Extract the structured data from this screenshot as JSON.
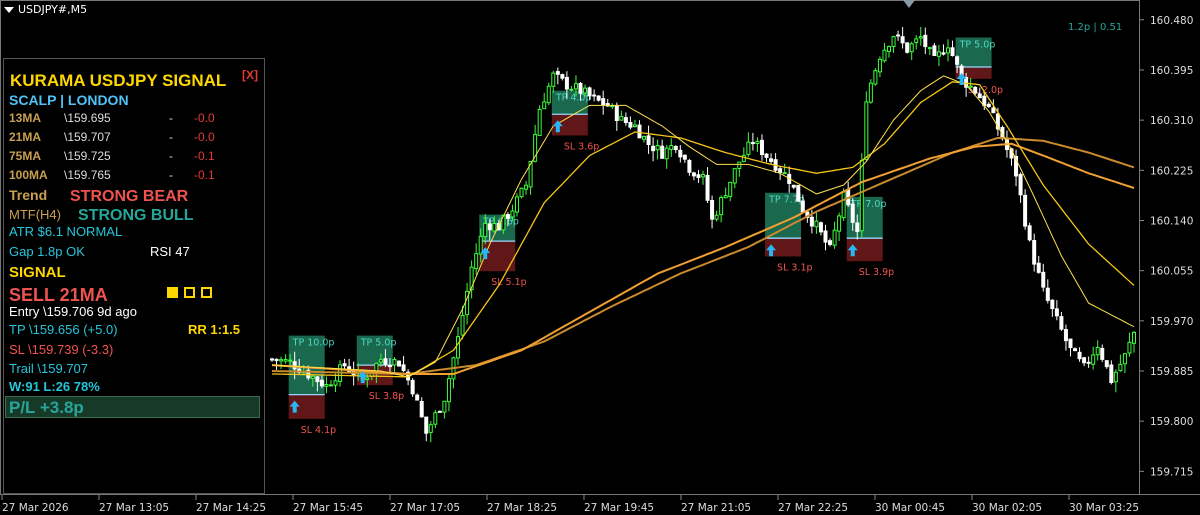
{
  "window": {
    "symbol": "USDJPY#,M5",
    "top_right_label": "1.2p | 0.51"
  },
  "panel": {
    "title": "KURAMA USDJPY SIGNAL",
    "close_label": "[X]",
    "subtitle": "SCALP | LONDON",
    "ma_rows": [
      {
        "label": "13MA",
        "value": "\\159.695",
        "dash": "-",
        "diff": "-0.0"
      },
      {
        "label": "21MA",
        "value": "\\159.707",
        "dash": "-",
        "diff": "-0.0"
      },
      {
        "label": "75MA",
        "value": "\\159.725",
        "dash": "-",
        "diff": "-0.1"
      },
      {
        "label": "100MA",
        "value": "\\159.765",
        "dash": "-",
        "diff": "-0.1"
      }
    ],
    "trend_label": "Trend",
    "trend_value": "STRONG BEAR",
    "mtf_label": "MTF(H4)",
    "mtf_value": "STRONG BULL",
    "atr": "ATR $6.1 NORMAL",
    "gap": "Gap 1.8p OK",
    "rsi": "RSI 47",
    "signal_heading": "SIGNAL",
    "signal_value": "SELL  21MA",
    "signal_strength": [
      true,
      false,
      false
    ],
    "entry": "Entry  \\159.706   9d ago",
    "tp": "TP  \\159.656  (+5.0)",
    "rr": "RR 1:1.5",
    "sl": "SL  \\159.739  (-3.3)",
    "trail": "Trail  \\159.707",
    "winloss": "W:91 L:26  78%",
    "pl": "P/L  +3.8p"
  },
  "colors": {
    "background": "#000000",
    "bull_candle": "#3bff3b",
    "bear_candle": "#ffffff",
    "ma_fast": "#ffe14d",
    "ma_slow": "#f0a030",
    "tp_zone": "#1f7a5c",
    "sl_zone": "#6b1a1a",
    "arrow": "#29b6f6"
  },
  "chart_data": {
    "type": "candlestick",
    "y_ticks": [
      "160.480",
      "160.395",
      "160.310",
      "160.225",
      "160.140",
      "160.055",
      "159.970",
      "159.885",
      "159.800",
      "159.715"
    ],
    "ylim": [
      159.68,
      160.5
    ],
    "x_ticks": [
      "27 Mar 2026",
      "27 Mar 13:05",
      "27 Mar 14:25",
      "27 Mar 15:45",
      "27 Mar 17:05",
      "27 Mar 18:25",
      "27 Mar 19:45",
      "27 Mar 21:05",
      "27 Mar 22:25",
      "30 Mar 00:45",
      "30 Mar 02:05",
      "30 Mar 03:25"
    ],
    "close_path": [
      [
        0,
        159.905
      ],
      [
        4,
        159.9
      ],
      [
        8,
        159.88
      ],
      [
        12,
        159.86
      ],
      [
        16,
        159.895
      ],
      [
        20,
        159.87
      ],
      [
        24,
        159.905
      ],
      [
        28,
        159.9
      ],
      [
        31,
        159.855
      ],
      [
        34,
        159.78
      ],
      [
        38,
        159.84
      ],
      [
        41,
        159.94
      ],
      [
        44,
        160.06
      ],
      [
        47,
        160.135
      ],
      [
        50,
        160.13
      ],
      [
        53,
        160.16
      ],
      [
        56,
        160.2
      ],
      [
        59,
        160.33
      ],
      [
        62,
        160.385
      ],
      [
        65,
        160.37
      ],
      [
        68,
        160.36
      ],
      [
        71,
        160.345
      ],
      [
        74,
        160.335
      ],
      [
        77,
        160.31
      ],
      [
        80,
        160.3
      ],
      [
        83,
        160.27
      ],
      [
        86,
        160.255
      ],
      [
        89,
        160.27
      ],
      [
        92,
        160.23
      ],
      [
        95,
        160.21
      ],
      [
        97,
        160.14
      ],
      [
        100,
        160.19
      ],
      [
        103,
        160.24
      ],
      [
        106,
        160.275
      ],
      [
        109,
        160.25
      ],
      [
        111,
        160.235
      ],
      [
        114,
        160.21
      ],
      [
        117,
        160.16
      ],
      [
        120,
        160.13
      ],
      [
        123,
        160.09
      ],
      [
        126,
        160.18
      ],
      [
        129,
        160.12
      ],
      [
        131,
        160.35
      ],
      [
        134,
        160.42
      ],
      [
        137,
        160.455
      ],
      [
        140,
        160.43
      ],
      [
        143,
        160.45
      ],
      [
        146,
        160.41
      ],
      [
        149,
        160.44
      ],
      [
        152,
        160.38
      ],
      [
        155,
        160.36
      ],
      [
        158,
        160.33
      ],
      [
        161,
        160.28
      ],
      [
        164,
        160.22
      ],
      [
        167,
        160.1
      ],
      [
        170,
        160.02
      ],
      [
        173,
        159.97
      ],
      [
        176,
        159.92
      ],
      [
        179,
        159.89
      ],
      [
        182,
        159.93
      ],
      [
        185,
        159.87
      ],
      [
        188,
        159.91
      ],
      [
        190,
        159.95
      ]
    ],
    "ma_fast": [
      [
        0,
        159.895
      ],
      [
        24,
        159.885
      ],
      [
        30,
        159.875
      ],
      [
        36,
        159.9
      ],
      [
        42,
        159.99
      ],
      [
        48,
        160.1
      ],
      [
        55,
        160.21
      ],
      [
        62,
        160.3
      ],
      [
        70,
        160.335
      ],
      [
        78,
        160.335
      ],
      [
        86,
        160.3
      ],
      [
        92,
        160.265
      ],
      [
        98,
        160.235
      ],
      [
        105,
        160.235
      ],
      [
        112,
        160.22
      ],
      [
        120,
        160.185
      ],
      [
        126,
        160.2
      ],
      [
        131,
        160.24
      ],
      [
        137,
        160.31
      ],
      [
        143,
        160.36
      ],
      [
        148,
        160.385
      ],
      [
        153,
        160.37
      ],
      [
        158,
        160.325
      ],
      [
        163,
        160.26
      ],
      [
        168,
        160.18
      ],
      [
        174,
        160.08
      ],
      [
        180,
        160.0
      ],
      [
        190,
        159.96
      ]
    ],
    "ma_mid": [
      [
        0,
        159.88
      ],
      [
        30,
        159.875
      ],
      [
        40,
        159.92
      ],
      [
        50,
        160.03
      ],
      [
        60,
        160.17
      ],
      [
        70,
        160.25
      ],
      [
        80,
        160.29
      ],
      [
        90,
        160.28
      ],
      [
        100,
        160.255
      ],
      [
        110,
        160.235
      ],
      [
        120,
        160.22
      ],
      [
        128,
        160.23
      ],
      [
        135,
        160.27
      ],
      [
        143,
        160.34
      ],
      [
        150,
        160.375
      ],
      [
        156,
        160.37
      ],
      [
        162,
        160.3
      ],
      [
        170,
        160.2
      ],
      [
        180,
        160.1
      ],
      [
        190,
        160.03
      ]
    ],
    "ma_slow1": [
      [
        0,
        159.895
      ],
      [
        30,
        159.88
      ],
      [
        40,
        159.88
      ],
      [
        55,
        159.92
      ],
      [
        70,
        159.985
      ],
      [
        85,
        160.05
      ],
      [
        100,
        160.095
      ],
      [
        115,
        160.145
      ],
      [
        130,
        160.205
      ],
      [
        145,
        160.245
      ],
      [
        155,
        160.265
      ],
      [
        163,
        160.27
      ],
      [
        170,
        160.25
      ],
      [
        180,
        160.22
      ],
      [
        190,
        160.195
      ]
    ],
    "ma_slow2": [
      [
        0,
        159.885
      ],
      [
        30,
        159.88
      ],
      [
        45,
        159.895
      ],
      [
        60,
        159.935
      ],
      [
        75,
        159.995
      ],
      [
        90,
        160.05
      ],
      [
        105,
        160.095
      ],
      [
        120,
        160.155
      ],
      [
        135,
        160.205
      ],
      [
        150,
        160.255
      ],
      [
        160,
        160.28
      ],
      [
        170,
        160.275
      ],
      [
        180,
        160.255
      ],
      [
        190,
        160.23
      ]
    ],
    "trades": [
      {
        "index": 5,
        "entry": 159.845,
        "tp": 159.945,
        "sl": 159.804,
        "tp_label": "TP 10.0p",
        "sl_label": "SL 4.1p"
      },
      {
        "index": 20,
        "entry": 159.895,
        "tp": 159.945,
        "sl": 159.861,
        "tp_label": "TP 5.0p",
        "sl_label": "SL 3.8p"
      },
      {
        "index": 47,
        "entry": 160.105,
        "tp": 160.15,
        "sl": 160.054,
        "tp_label": "TP 6.6p",
        "sl_label": "SL 5.1p"
      },
      {
        "index": 63,
        "entry": 160.32,
        "tp": 160.36,
        "sl": 160.284,
        "tp_label": "TP 4.0p",
        "sl_label": "SL 3.6p"
      },
      {
        "index": 110,
        "entry": 160.11,
        "tp": 160.187,
        "sl": 160.079,
        "tp_label": "TP 7.7p",
        "sl_label": "SL 3.1p"
      },
      {
        "index": 128,
        "entry": 160.11,
        "tp": 160.18,
        "sl": 160.071,
        "tp_label": "TP 7.0p",
        "sl_label": "SL 3.9p"
      },
      {
        "index": 152,
        "entry": 160.4,
        "tp": 160.45,
        "sl": 160.38,
        "tp_label": "TP 5.0p",
        "sl_label": "SL 2.0p"
      }
    ]
  }
}
